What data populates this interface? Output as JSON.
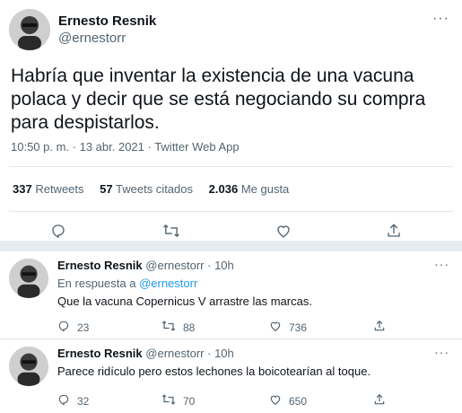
{
  "main": {
    "author_name": "Ernesto Resnik",
    "author_handle": "@ernestorr",
    "more": "···",
    "text": "Habría que inventar la existencia de una vacuna polaca y decir que se está negociando su compra para despistarlos.",
    "timestamp": "10:50 p. m. · 13 abr. 2021 · Twitter Web App",
    "stats": {
      "retweets_count": "337",
      "retweets_label": "Retweets",
      "quotes_count": "57",
      "quotes_label": "Tweets citados",
      "likes_count": "2.036",
      "likes_label": "Me gusta"
    },
    "actions": {
      "reply_icon": "reply-icon",
      "retweet_icon": "retweet-icon",
      "like_icon": "like-icon",
      "share_icon": "share-icon"
    }
  },
  "replies": [
    {
      "author_name": "Ernesto Resnik",
      "author_handle": "@ernestorr",
      "time": "· 10h",
      "in_reply_prefix": "En respuesta a",
      "in_reply_mention": "@ernestorr",
      "text": "Que la vacuna Copernicus V arrastre las marcas.",
      "reply_count": "23",
      "retweet_count": "88",
      "like_count": "736"
    },
    {
      "author_name": "Ernesto Resnik",
      "author_handle": "@ernestorr",
      "time": "· 10h",
      "text": "Parece ridículo pero estos lechones la boicotearían al toque.",
      "reply_count": "32",
      "retweet_count": "70",
      "like_count": "650"
    }
  ],
  "colors": {
    "text": "#0f1419",
    "secondary": "#536471",
    "link": "#1d9bf0",
    "divider": "#e1e6ea"
  }
}
